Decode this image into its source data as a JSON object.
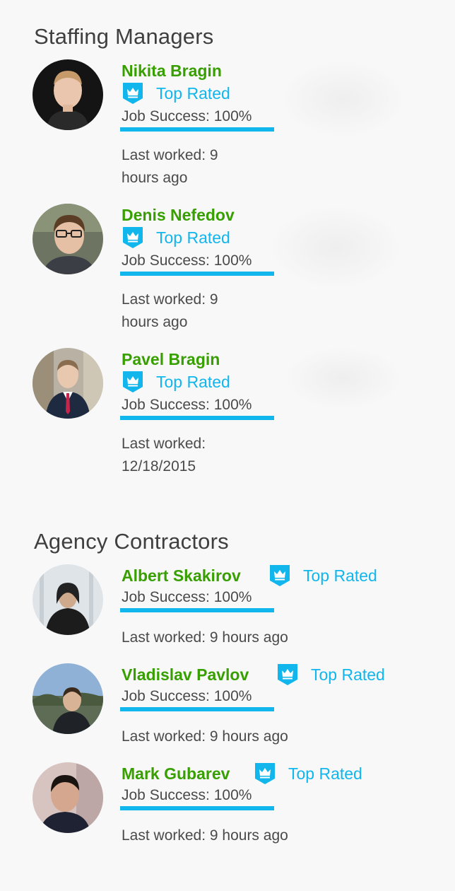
{
  "sections": [
    {
      "title": "Staffing Managers",
      "people": [
        {
          "name": "Nikita Bragin",
          "badge": "Top Rated",
          "job_success": "Job Success: 100%",
          "job_success_percent": 100,
          "last_worked": "Last worked: 9 hours ago"
        },
        {
          "name": "Denis Nefedov",
          "badge": "Top Rated",
          "job_success": "Job Success: 100%",
          "job_success_percent": 100,
          "last_worked": "Last worked: 9 hours ago"
        },
        {
          "name": "Pavel Bragin",
          "badge": "Top Rated",
          "job_success": "Job Success: 100%",
          "job_success_percent": 100,
          "last_worked": "Last worked: 12/18/2015"
        }
      ]
    },
    {
      "title": "Agency Contractors",
      "people": [
        {
          "name": "Albert Skakirov",
          "badge": "Top Rated",
          "job_success": "Job Success: 100%",
          "job_success_percent": 100,
          "last_worked": "Last worked: 9 hours ago"
        },
        {
          "name": "Vladislav Pavlov",
          "badge": "Top Rated",
          "job_success": "Job Success: 100%",
          "job_success_percent": 100,
          "last_worked": "Last worked: 9 hours ago"
        },
        {
          "name": "Mark Gubarev",
          "badge": "Top Rated",
          "job_success": "Job Success: 100%",
          "job_success_percent": 100,
          "last_worked": "Last worked: 9 hours ago"
        }
      ]
    }
  ],
  "icons": {
    "badge": "top-rated-crown-badge-icon"
  },
  "colors": {
    "name": "#37a000",
    "badge": "#10b6ec",
    "success_bar": "#10b6ec",
    "text": "#4a4a4a",
    "heading": "#3f3f3f",
    "background": "#f8f8f8"
  }
}
